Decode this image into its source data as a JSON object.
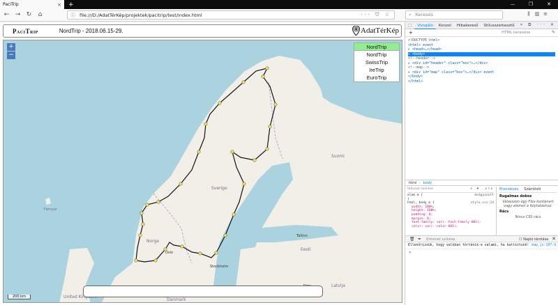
{
  "browser": {
    "tab_title": "PaciTrip",
    "url": "file:///D:/AdatTérKép/projektek/pacitrip/test/index.html",
    "search_placeholder": "Keresés"
  },
  "app": {
    "logo": "PaciTrip",
    "trip_title": "NordTrip - 2018.06.15-29.",
    "brand": "AdatTérKép",
    "zoom_in": "+",
    "zoom_out": "−",
    "menu": [
      "NordTrip",
      "NordTrip",
      "SwissTrip",
      "IreTrip",
      "EuroTrip"
    ],
    "scale": "200 km"
  },
  "map": {
    "labels": [
      {
        "text": "Sverige"
      },
      {
        "text": "Suomi"
      },
      {
        "text": "Norge"
      },
      {
        "text": "Eesti"
      },
      {
        "text": "Latvija"
      },
      {
        "text": "Danmark"
      },
      {
        "text": "Stockholm"
      },
      {
        "text": "Oslo"
      },
      {
        "text": "Tallinn"
      },
      {
        "text": "Riga"
      },
      {
        "text": "United Kingdom"
      },
      {
        "text": "Føroyar"
      }
    ],
    "colors": {
      "land": "#f2efe9",
      "water": "#aad3df",
      "route": "#111111",
      "stop": "#f5e84a"
    }
  },
  "devtools": {
    "tabs": [
      "Vizsgáló",
      "Konzol",
      "Hibakereső",
      "Stílusszerkesztő"
    ],
    "html_search": "HTML keresése",
    "markup": [
      "<!DOCTYPE html>",
      "<html> event",
      "▸ <head>…</head>",
      "▾ <body>",
      "    <!--header-->",
      "  ▸ <div id=\"header\" class=\"box\">…</div>",
      "    <!--map-->",
      "  ▸ <div id=\"map\" class=\"box\">…</div> event",
      "  </body>",
      "</html>"
    ],
    "breadcrumbs": [
      "html",
      "body"
    ],
    "rules_filter": "Stílusok szűrése",
    "rules": [
      "elem ⚙ {",
      "}",
      "html, body ⚙ {",
      "width: 100%;",
      "height: 100%;",
      "padding: 0;",
      "margin: 0;",
      "font-family: var(--font-family-001);",
      "color: var(--color-001);"
    ],
    "rules_sources": [
      "beágyazott",
      "style.css:24"
    ],
    "side_tabs": [
      "Elrendezés",
      "Számított"
    ],
    "flex_title": "Rugalmas doboz",
    "flex_note": "Válasszon egy Flex konténert vagy elemet a folytatáshoz.",
    "grid_title": "Rács",
    "grid_note": "Nincs CSS rács",
    "console_filter": "Kimenet szűrése",
    "persist": "Napló tárolása",
    "console_message": "Ellenőrizzük, hogy valóban történik-e valami, ha kattintunk!",
    "console_location": "map.js:107:9"
  }
}
